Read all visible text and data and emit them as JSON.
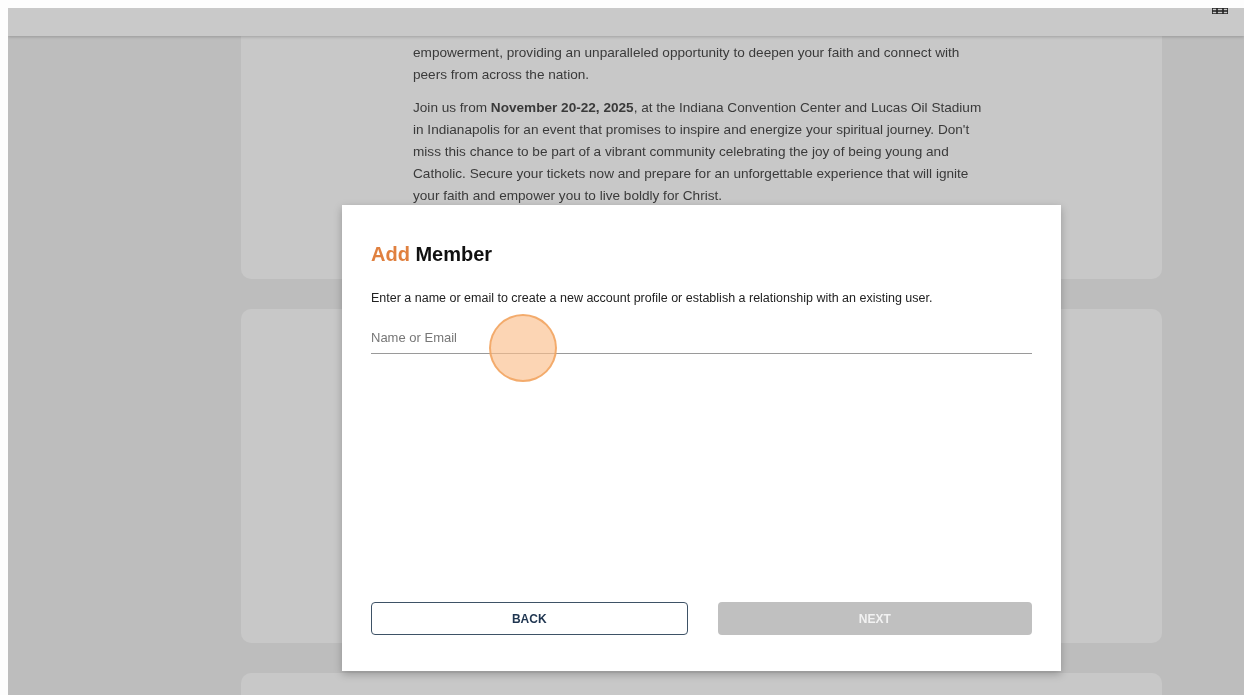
{
  "background_card": {
    "paragraphs": [
      "empowerment, providing an unparalleled opportunity to deepen your faith and connect with peers from across the nation.",
      "Join us from **November 20-22, 2025**, at the Indiana Convention Center and Lucas Oil Stadium in Indianapolis for an event that promises to inspire and energize your spiritual journey. Don't miss this chance to be part of a vibrant community celebrating the joy of being young and Catholic. Secure your tickets now and prepare for an unforgettable experience that will ignite your faith and empower you to live boldly for Christ."
    ]
  },
  "dialog": {
    "title_accent": "Add",
    "title": "Member",
    "description": "Enter a name or email to create a new account profile or establish a relationship with an existing user.",
    "field": {
      "placeholder": "Name or Email"
    },
    "buttons": [
      {
        "label": "BACK",
        "kind": "outline",
        "disabled": false
      },
      {
        "label": "NEXT",
        "kind": "filled",
        "disabled": true
      }
    ]
  }
}
